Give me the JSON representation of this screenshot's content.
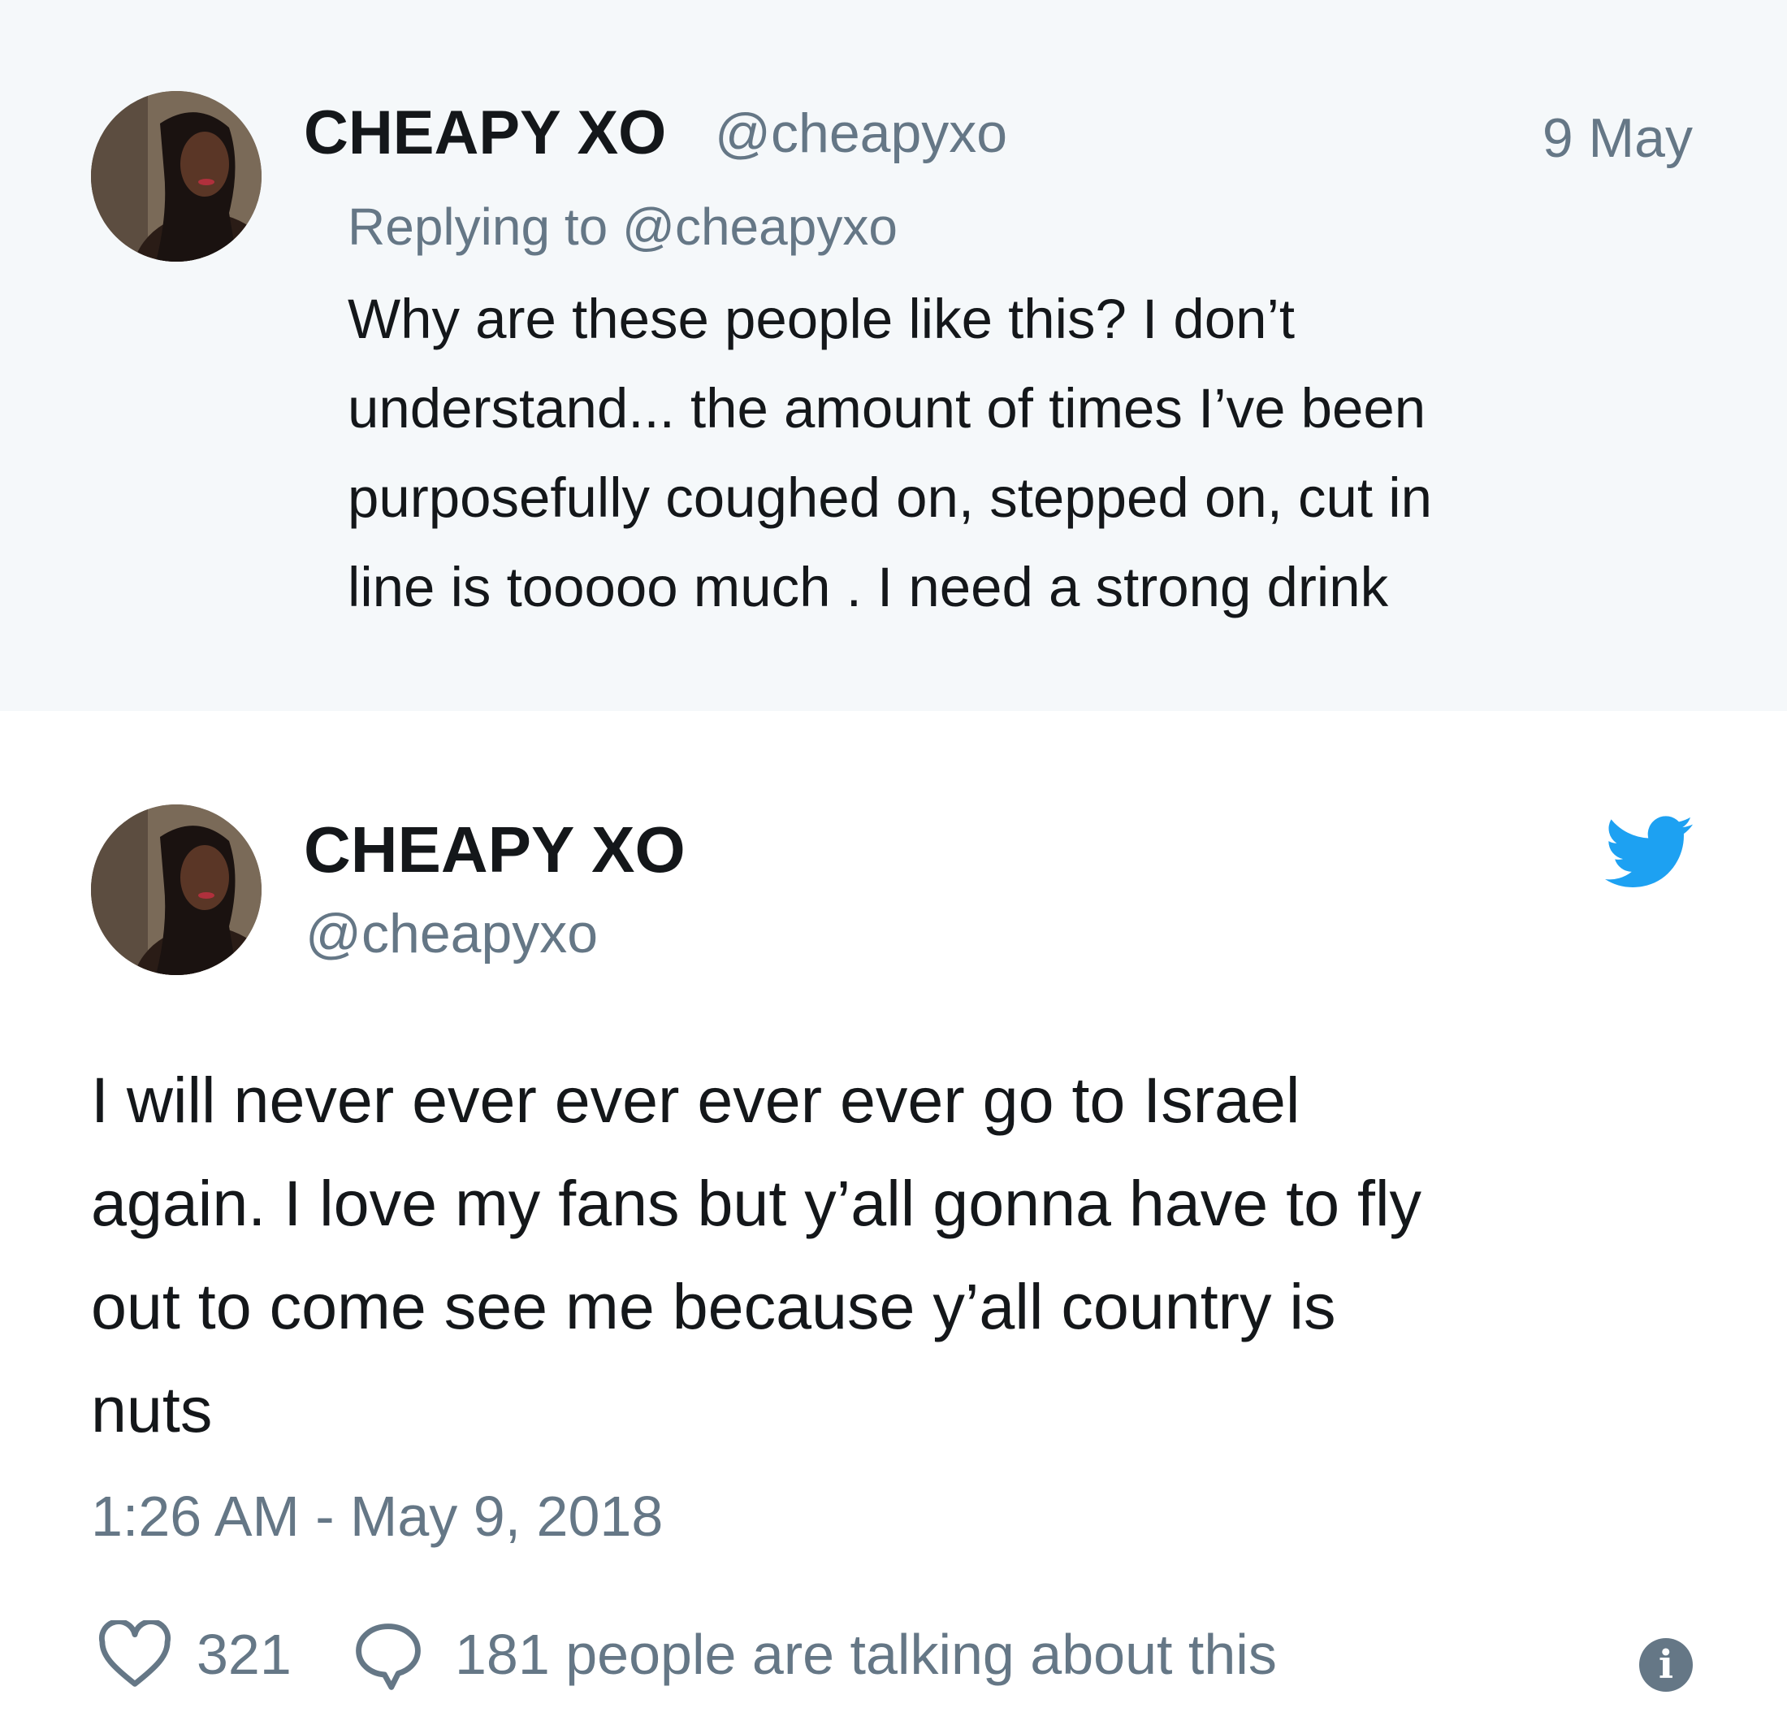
{
  "reply_tweet": {
    "display_name": "CHEAPY XO",
    "handle": "@cheapyxo",
    "date": "9 May",
    "replying_prefix": "Replying to",
    "replying_to": "@cheapyxo",
    "text_lines": [
      "Why are these people like this? I don’t",
      "understand... the amount of times I’ve been",
      "purposefully coughed on, stepped on, cut in",
      "line is tooooo much . I need a strong drink"
    ]
  },
  "main_tweet": {
    "display_name": "CHEAPY XO",
    "handle": "@cheapyxo",
    "text_lines": [
      "I will never ever ever ever ever go to Israel",
      "again. I love my fans but y’all gonna have to fly",
      "out to come see me because y’all country is",
      "nuts"
    ],
    "timestamp": "1:26 AM - May 9, 2018",
    "likes": "321",
    "talking": "181 people are talking about this"
  },
  "icons": {
    "brand": "twitter-bird-icon",
    "like": "heart-icon",
    "reply": "speech-bubble-icon",
    "info": "info-icon"
  },
  "colors": {
    "twitter_blue": "#1da1f2",
    "text_primary": "#14171a",
    "text_secondary": "#657786",
    "reply_background": "#f5f8fa"
  }
}
